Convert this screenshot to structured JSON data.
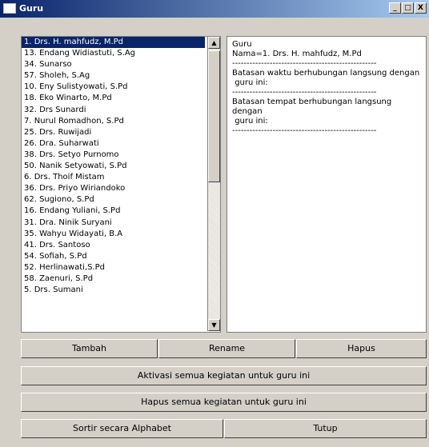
{
  "window": {
    "title": "Guru",
    "min_label": "_",
    "max_label": "□",
    "close_label": "X"
  },
  "list": {
    "items": [
      "1. Drs. H. mahfudz, M.Pd",
      "13. Endang Widiastuti, S.Ag",
      "34. Sunarso",
      "57. Sholeh, S.Ag",
      "10. Eny Sulistyowati, S.Pd",
      "18. Eko Winarto, M.Pd",
      "32. Drs Sunardi",
      "7. Nurul Romadhon, S.Pd",
      "25. Drs. Ruwijadi",
      "26. Dra. Suharwati",
      "38. Drs. Setyo Purnomo",
      "50. Nanik Setyowati, S.Pd",
      "6. Drs. Thoif Mistam",
      "36. Drs. Priyo Wiriandoko",
      "62. Sugiono, S.Pd",
      "16. Endang Yuliani, S.Pd",
      "31. Dra. Ninik Suryani",
      "35. Wahyu Widayati, B.A",
      "41. Drs. Santoso",
      "54. Sofiah, S.Pd",
      "52. Herlinawati,S.Pd",
      "58. Zaenuri, S.Pd",
      "5. Drs. Sumani"
    ],
    "selected_index": 0
  },
  "detail": {
    "lines": [
      "Guru",
      "Nama=1. Drs. H. mahfudz, M.Pd",
      "--------------------------------------------------",
      "Batasan waktu berhubungan langsung dengan",
      " guru ini:",
      "--------------------------------------------------",
      "Batasan tempat berhubungan langsung dengan",
      " guru ini:",
      "--------------------------------------------------"
    ]
  },
  "buttons": {
    "add": "Tambah",
    "rename": "Rename",
    "delete": "Hapus",
    "activate_all": "Aktivasi semua kegiatan untuk guru ini",
    "delete_all": "Hapus semua kegiatan untuk guru ini",
    "sort": "Sortir secara Alphabet",
    "close": "Tutup"
  }
}
